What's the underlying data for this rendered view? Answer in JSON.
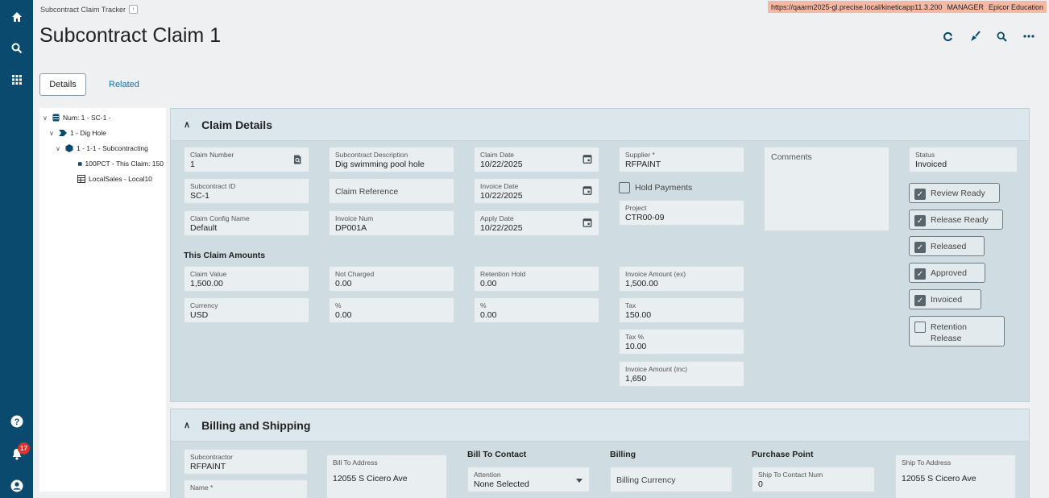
{
  "rail": {
    "icons": [
      "home-icon",
      "search-icon",
      "apps-grid-icon",
      "help-icon",
      "bell-icon",
      "user-icon"
    ],
    "notification_count": "17"
  },
  "breadcrumb": {
    "label": "Subcontract Claim Tracker"
  },
  "env": {
    "url": "https://qaarm2025-gl.precise.local/kineticapp11.3.200",
    "user": "MANAGER",
    "company": "Epicor Education"
  },
  "page": {
    "title": "Subcontract Claim 1"
  },
  "tabs": {
    "details": "Details",
    "related": "Related"
  },
  "tree": {
    "items": [
      {
        "label": "Num: 1 - SC-1 -"
      },
      {
        "label": "1 - Dig Hole"
      },
      {
        "label": "1 - 1-1 - Subcontracting"
      },
      {
        "label": "100PCT - This Claim: 150"
      },
      {
        "label": "LocalSales - Local10"
      }
    ]
  },
  "claim_details": {
    "title": "Claim Details",
    "claim_number": {
      "label": "Claim Number",
      "value": "1"
    },
    "subcontract_description": {
      "label": "Subcontract Description",
      "value": "Dig swimming pool hole"
    },
    "claim_date": {
      "label": "Claim Date",
      "value": "10/22/2025"
    },
    "supplier": {
      "label": "Supplier *",
      "value": "RFPAINT"
    },
    "comments": {
      "label": "Comments"
    },
    "status": {
      "label": "Status",
      "value": "Invoiced"
    },
    "subcontract_id": {
      "label": "Subcontract ID",
      "value": "SC-1"
    },
    "claim_reference": {
      "label": "Claim Reference"
    },
    "invoice_date": {
      "label": "Invoice Date",
      "value": "10/22/2025"
    },
    "hold_payments": {
      "label": "Hold Payments"
    },
    "claim_config_name": {
      "label": "Claim Config Name",
      "value": "Default"
    },
    "invoice_num": {
      "label": "Invoice Num",
      "value": "DP001A"
    },
    "apply_date": {
      "label": "Apply Date",
      "value": "10/22/2025"
    },
    "project": {
      "label": "Project",
      "value": "CTR00-09"
    },
    "checks": {
      "review_ready": "Review Ready",
      "release_ready": "Release Ready",
      "released": "Released",
      "approved": "Approved",
      "invoiced": "Invoiced",
      "retention_release": "Retention Release"
    },
    "amounts_heading": "This Claim Amounts",
    "claim_value": {
      "label": "Claim Value",
      "value": "1,500.00"
    },
    "not_charged": {
      "label": "Not Charged",
      "value": "0.00"
    },
    "retention_hold": {
      "label": "Retention Hold",
      "value": "0.00"
    },
    "invoice_amount_ex": {
      "label": "Invoice Amount (ex)",
      "value": "1,500.00"
    },
    "currency": {
      "label": "Currency",
      "value": "USD"
    },
    "pct1": {
      "label": "%",
      "value": "0.00"
    },
    "pct2": {
      "label": "%",
      "value": "0.00"
    },
    "tax": {
      "label": "Tax",
      "value": "150.00"
    },
    "tax_pct": {
      "label": "Tax %",
      "value": "10.00"
    },
    "invoice_amount_inc": {
      "label": "Invoice Amount (inc)",
      "value": "1,650"
    }
  },
  "billing": {
    "title": "Billing and Shipping",
    "subcontractor": {
      "label": "Subcontractor",
      "value": "RFPAINT"
    },
    "name": {
      "label": "Name *"
    },
    "bill_to_address": {
      "label": "Bill To Address",
      "value": "12055 S Cicero Ave"
    },
    "bill_to_contact_heading": "Bill To Contact",
    "attention": {
      "label": "Attention",
      "value": "None Selected"
    },
    "billing_heading": "Billing",
    "billing_currency": {
      "label": "Billing Currency"
    },
    "purchase_point_heading": "Purchase Point",
    "ship_to_contact_num": {
      "label": "Ship To Contact Num",
      "value": "0"
    },
    "ship_to_address": {
      "label": "Ship To Address",
      "value": "12055 S Cicero Ave"
    }
  }
}
